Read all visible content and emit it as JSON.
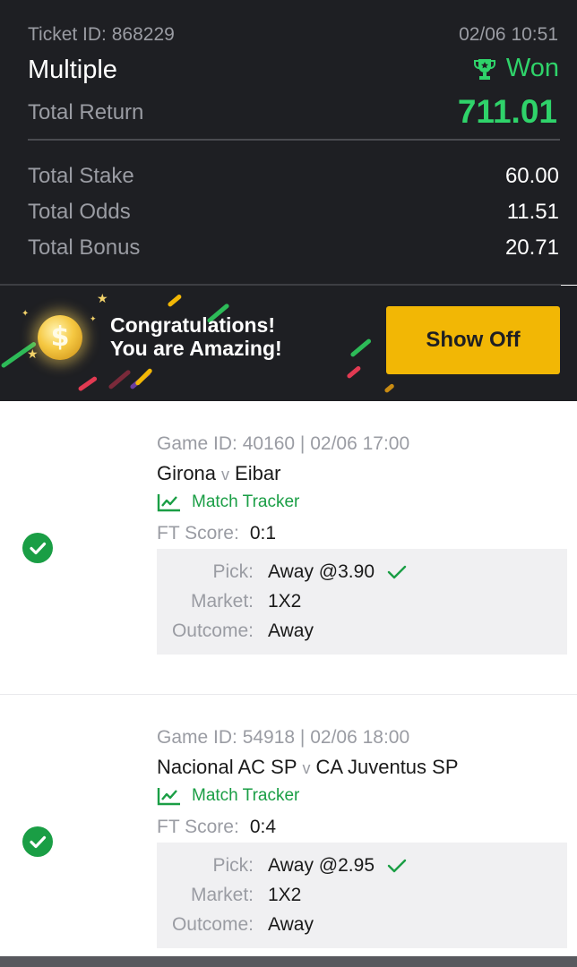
{
  "ticket": {
    "id_text": "Ticket ID: 868229",
    "date": "02/06 10:51",
    "bet_type": "Multiple",
    "status": "Won",
    "total_return_label": "Total Return",
    "total_return_value": "711.01"
  },
  "summary": [
    {
      "label": "Total Stake",
      "value": "60.00"
    },
    {
      "label": "Total Odds",
      "value": "11.51"
    },
    {
      "label": "Total Bonus",
      "value": "20.71"
    }
  ],
  "banner": {
    "line1": "Congratulations!",
    "line2": "You are Amazing!",
    "button_label": "Show Off",
    "coin_glyph": "$"
  },
  "selections": [
    {
      "meta": "Game ID: 40160 | 02/06 17:00",
      "home": "Girona",
      "vs": "v",
      "away": "Eibar",
      "tracker_label": "Match Tracker",
      "ft_label": "FT Score:",
      "ft_score": "0:1",
      "pick_label": "Pick:",
      "pick_value": "Away @3.90",
      "market_label": "Market:",
      "market_value": "1X2",
      "outcome_label": "Outcome:",
      "outcome_value": "Away"
    },
    {
      "meta": "Game ID: 54918 | 02/06 18:00",
      "home": "Nacional AC SP",
      "vs": "v",
      "away": "CA Juventus SP",
      "tracker_label": "Match Tracker",
      "ft_label": "FT Score:",
      "ft_score": "0:4",
      "pick_label": "Pick:",
      "pick_value": "Away @2.95",
      "market_label": "Market:",
      "market_value": "1X2",
      "outcome_label": "Outcome:",
      "outcome_value": "Away"
    }
  ],
  "colors": {
    "header_bg": "#1e1f23",
    "won_green": "#2fd36a",
    "check_green": "#1a9e45",
    "button_yellow": "#f2b705"
  },
  "icons": {
    "status": "trophy-icon",
    "selection_status": "check-circle-icon",
    "tracker": "line-chart-icon",
    "pick_result": "check-icon"
  }
}
